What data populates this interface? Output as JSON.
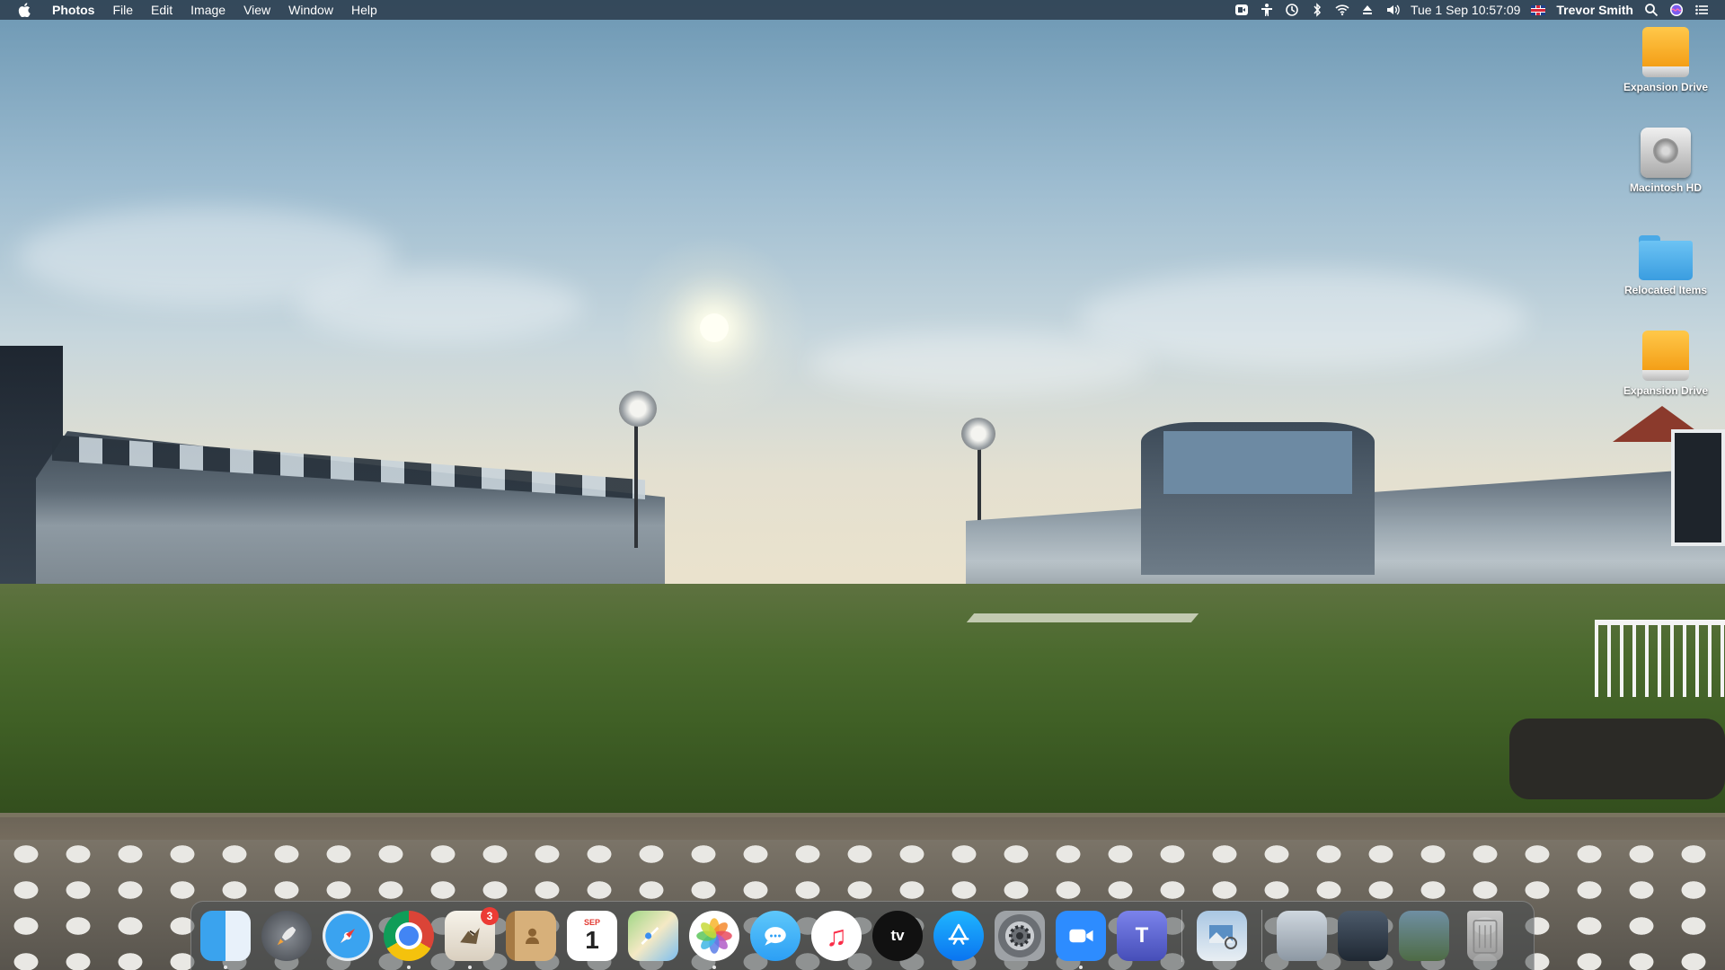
{
  "menubar": {
    "app_name": "Photos",
    "menus": [
      "File",
      "Edit",
      "Image",
      "View",
      "Window",
      "Help"
    ],
    "tray_icons": [
      "screen-record-icon",
      "accessibility-icon",
      "time-machine-icon",
      "bluetooth-icon",
      "wifi-icon",
      "eject-icon",
      "volume-icon"
    ],
    "clock": "Tue 1 Sep  10:57:09",
    "input_source": "uk-flag-icon",
    "user": "Trevor Smith",
    "right_icons": [
      "spotlight-icon",
      "siri-icon",
      "notification-center-icon"
    ]
  },
  "desktop": {
    "icons": [
      {
        "label": "Expansion Drive",
        "type": "external-drive-icon"
      },
      {
        "label": "Macintosh HD",
        "type": "hard-drive-icon"
      },
      {
        "label": "Relocated Items",
        "type": "folder-icon"
      },
      {
        "label": "Expansion Drive",
        "type": "external-drive-icon"
      }
    ]
  },
  "dock": {
    "apps": [
      {
        "name": "Finder",
        "icon": "finder-icon",
        "running": true
      },
      {
        "name": "Launchpad",
        "icon": "launchpad-icon",
        "running": false
      },
      {
        "name": "Safari",
        "icon": "safari-icon",
        "running": false
      },
      {
        "name": "Google Chrome",
        "icon": "chrome-icon",
        "running": true
      },
      {
        "name": "Mail",
        "icon": "mail-icon",
        "running": true,
        "badge": "3"
      },
      {
        "name": "Contacts",
        "icon": "contacts-icon",
        "running": false
      },
      {
        "name": "Calendar",
        "icon": "calendar-icon",
        "running": false,
        "month": "SEP",
        "day": "1"
      },
      {
        "name": "Maps",
        "icon": "maps-icon",
        "running": false
      },
      {
        "name": "Photos",
        "icon": "photos-icon",
        "running": true
      },
      {
        "name": "Messages",
        "icon": "messages-icon",
        "running": false
      },
      {
        "name": "Music",
        "icon": "music-icon",
        "running": false
      },
      {
        "name": "TV",
        "icon": "apple-tv-icon",
        "running": false,
        "text": "tv"
      },
      {
        "name": "App Store",
        "icon": "app-store-icon",
        "running": false
      },
      {
        "name": "System Preferences",
        "icon": "system-preferences-icon",
        "running": false
      },
      {
        "name": "Zoom",
        "icon": "zoom-icon",
        "running": true
      },
      {
        "name": "Microsoft Teams",
        "icon": "teams-icon",
        "running": false,
        "text": "T"
      }
    ],
    "recent": [
      {
        "name": "Preview",
        "icon": "preview-icon"
      }
    ],
    "stacks": [
      {
        "name": "Documents",
        "icon": "stack-icon"
      },
      {
        "name": "Downloads",
        "icon": "stack-icon"
      },
      {
        "name": "Pictures",
        "icon": "stack-icon"
      },
      {
        "name": "Trash",
        "icon": "trash-icon"
      }
    ]
  },
  "colors": {
    "menubar": "#304254",
    "dock_background": "#464a4e",
    "badge": "#ec3b35"
  }
}
